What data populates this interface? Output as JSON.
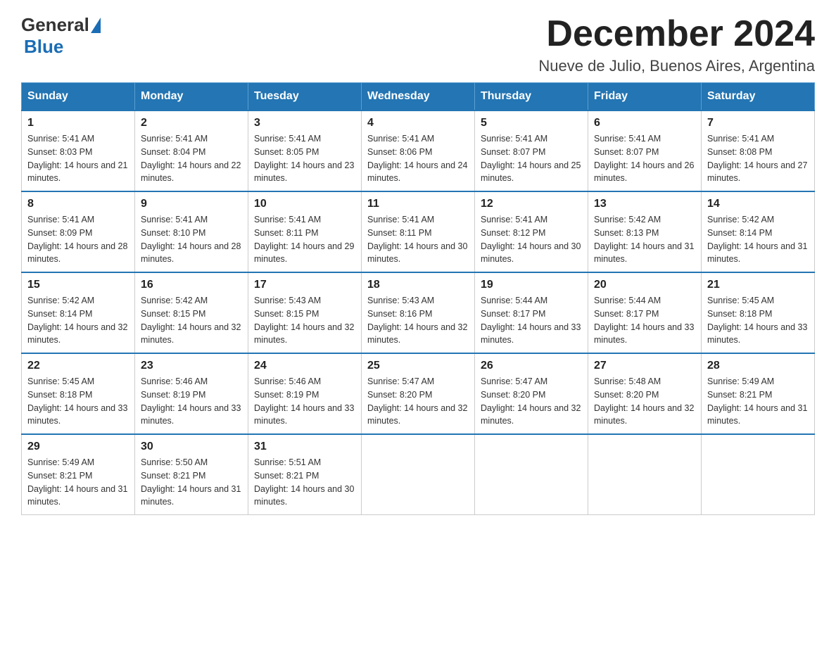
{
  "header": {
    "logo": {
      "general": "General",
      "blue": "Blue"
    },
    "title": "December 2024",
    "location": "Nueve de Julio, Buenos Aires, Argentina"
  },
  "weekdays": [
    "Sunday",
    "Monday",
    "Tuesday",
    "Wednesday",
    "Thursday",
    "Friday",
    "Saturday"
  ],
  "weeks": [
    [
      {
        "day": "1",
        "sunrise": "5:41 AM",
        "sunset": "8:03 PM",
        "daylight": "14 hours and 21 minutes."
      },
      {
        "day": "2",
        "sunrise": "5:41 AM",
        "sunset": "8:04 PM",
        "daylight": "14 hours and 22 minutes."
      },
      {
        "day": "3",
        "sunrise": "5:41 AM",
        "sunset": "8:05 PM",
        "daylight": "14 hours and 23 minutes."
      },
      {
        "day": "4",
        "sunrise": "5:41 AM",
        "sunset": "8:06 PM",
        "daylight": "14 hours and 24 minutes."
      },
      {
        "day": "5",
        "sunrise": "5:41 AM",
        "sunset": "8:07 PM",
        "daylight": "14 hours and 25 minutes."
      },
      {
        "day": "6",
        "sunrise": "5:41 AM",
        "sunset": "8:07 PM",
        "daylight": "14 hours and 26 minutes."
      },
      {
        "day": "7",
        "sunrise": "5:41 AM",
        "sunset": "8:08 PM",
        "daylight": "14 hours and 27 minutes."
      }
    ],
    [
      {
        "day": "8",
        "sunrise": "5:41 AM",
        "sunset": "8:09 PM",
        "daylight": "14 hours and 28 minutes."
      },
      {
        "day": "9",
        "sunrise": "5:41 AM",
        "sunset": "8:10 PM",
        "daylight": "14 hours and 28 minutes."
      },
      {
        "day": "10",
        "sunrise": "5:41 AM",
        "sunset": "8:11 PM",
        "daylight": "14 hours and 29 minutes."
      },
      {
        "day": "11",
        "sunrise": "5:41 AM",
        "sunset": "8:11 PM",
        "daylight": "14 hours and 30 minutes."
      },
      {
        "day": "12",
        "sunrise": "5:41 AM",
        "sunset": "8:12 PM",
        "daylight": "14 hours and 30 minutes."
      },
      {
        "day": "13",
        "sunrise": "5:42 AM",
        "sunset": "8:13 PM",
        "daylight": "14 hours and 31 minutes."
      },
      {
        "day": "14",
        "sunrise": "5:42 AM",
        "sunset": "8:14 PM",
        "daylight": "14 hours and 31 minutes."
      }
    ],
    [
      {
        "day": "15",
        "sunrise": "5:42 AM",
        "sunset": "8:14 PM",
        "daylight": "14 hours and 32 minutes."
      },
      {
        "day": "16",
        "sunrise": "5:42 AM",
        "sunset": "8:15 PM",
        "daylight": "14 hours and 32 minutes."
      },
      {
        "day": "17",
        "sunrise": "5:43 AM",
        "sunset": "8:15 PM",
        "daylight": "14 hours and 32 minutes."
      },
      {
        "day": "18",
        "sunrise": "5:43 AM",
        "sunset": "8:16 PM",
        "daylight": "14 hours and 32 minutes."
      },
      {
        "day": "19",
        "sunrise": "5:44 AM",
        "sunset": "8:17 PM",
        "daylight": "14 hours and 33 minutes."
      },
      {
        "day": "20",
        "sunrise": "5:44 AM",
        "sunset": "8:17 PM",
        "daylight": "14 hours and 33 minutes."
      },
      {
        "day": "21",
        "sunrise": "5:45 AM",
        "sunset": "8:18 PM",
        "daylight": "14 hours and 33 minutes."
      }
    ],
    [
      {
        "day": "22",
        "sunrise": "5:45 AM",
        "sunset": "8:18 PM",
        "daylight": "14 hours and 33 minutes."
      },
      {
        "day": "23",
        "sunrise": "5:46 AM",
        "sunset": "8:19 PM",
        "daylight": "14 hours and 33 minutes."
      },
      {
        "day": "24",
        "sunrise": "5:46 AM",
        "sunset": "8:19 PM",
        "daylight": "14 hours and 33 minutes."
      },
      {
        "day": "25",
        "sunrise": "5:47 AM",
        "sunset": "8:20 PM",
        "daylight": "14 hours and 32 minutes."
      },
      {
        "day": "26",
        "sunrise": "5:47 AM",
        "sunset": "8:20 PM",
        "daylight": "14 hours and 32 minutes."
      },
      {
        "day": "27",
        "sunrise": "5:48 AM",
        "sunset": "8:20 PM",
        "daylight": "14 hours and 32 minutes."
      },
      {
        "day": "28",
        "sunrise": "5:49 AM",
        "sunset": "8:21 PM",
        "daylight": "14 hours and 31 minutes."
      }
    ],
    [
      {
        "day": "29",
        "sunrise": "5:49 AM",
        "sunset": "8:21 PM",
        "daylight": "14 hours and 31 minutes."
      },
      {
        "day": "30",
        "sunrise": "5:50 AM",
        "sunset": "8:21 PM",
        "daylight": "14 hours and 31 minutes."
      },
      {
        "day": "31",
        "sunrise": "5:51 AM",
        "sunset": "8:21 PM",
        "daylight": "14 hours and 30 minutes."
      },
      null,
      null,
      null,
      null
    ]
  ],
  "labels": {
    "sunrise": "Sunrise:",
    "sunset": "Sunset:",
    "daylight": "Daylight:"
  }
}
